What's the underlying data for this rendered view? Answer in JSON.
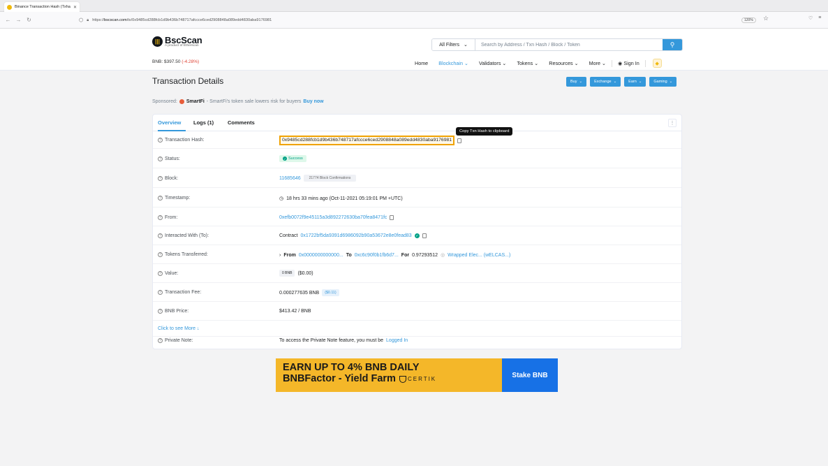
{
  "browser": {
    "tab_title": "Binance Transaction Hash (Txhas",
    "url_prefix": "https://",
    "url_domain": "bscscan.com",
    "url_path": "/tx/0x9485cd288fcb1d9b436b748717afccce6ced2908848a089edd4830aba9176981",
    "zoom": "120%"
  },
  "header": {
    "logo_name": "BscScan",
    "logo_sub": "A product of Etherscan",
    "bnb_price_label": "BNB: $397.50",
    "bnb_price_change": "(-4.28%)",
    "filter_label": "All Filters",
    "search_placeholder": "Search by Address / Txn Hash / Block / Token",
    "nav": {
      "home": "Home",
      "blockchain": "Blockchain",
      "validators": "Validators",
      "tokens": "Tokens",
      "resources": "Resources",
      "more": "More",
      "sign_in": "Sign In"
    }
  },
  "page": {
    "title": "Transaction Details",
    "buttons": {
      "buy": "Buy",
      "exchange": "Exchange",
      "earn": "Earn",
      "gaming": "Gaming"
    },
    "sponsored_label": "Sponsored:",
    "sponsor_name": "SmartFi",
    "sponsor_text": "- SmartFi's token sale lowers risk for buyers",
    "sponsor_cta": "Buy now"
  },
  "tabs": {
    "overview": "Overview",
    "logs": "Logs (1)",
    "comments": "Comments"
  },
  "tooltip": "Copy Txn Hash to clipboard",
  "details": {
    "tx_hash_label": "Transaction Hash:",
    "tx_hash": "0x9485cd288fcb1d9b436b748717afccce6ced2908848a089edd4830aba9176981",
    "status_label": "Status:",
    "status": "Success",
    "block_label": "Block:",
    "block": "11685646",
    "confirmations": "21774 Block Confirmations",
    "timestamp_label": "Timestamp:",
    "timestamp": "18 hrs 33 mins ago (Oct-11-2021 05:19:01 PM +UTC)",
    "from_label": "From:",
    "from": "0xefb0072f9e45115a3d892272630ba70fea8471fc",
    "interacted_label": "Interacted With (To):",
    "contract_word": "Contract",
    "contract": "0x1722bf5da9391d6986092b90a53672e8e0fead83",
    "tokens_label": "Tokens Transferred:",
    "tt_from_word": "From",
    "tt_from": "0x0000000000000...",
    "tt_to_word": "To",
    "tt_to": "0xc6c90f0b1fb6d7...",
    "tt_for_word": "For",
    "tt_amount": "0.97293512",
    "tt_token": "Wrapped Elec... (wELCAS...)",
    "value_label": "Value:",
    "value_bnb": "0 BNB",
    "value_usd": "($0.00)",
    "fee_label": "Transaction Fee:",
    "fee_bnb": "0.000277635 BNB",
    "fee_usd": "($0.11)",
    "price_label": "BNB Price:",
    "price": "$413.42 / BNB",
    "more_link": "Click to see More",
    "note_label": "Private Note:",
    "note_text": "To access the Private Note feature, you must be",
    "note_link": "Logged In"
  },
  "banner": {
    "line1": "EARN UP TO 4% BNB DAILY",
    "line2": "BNBFactor - Yield Farm",
    "certik": "CERTIK",
    "cta": "Stake BNB"
  },
  "icons": [
    "search-icon",
    "question-icon",
    "copy-icon",
    "check-icon",
    "clock-icon",
    "user-icon",
    "bnb-icon",
    "kebab-icon"
  ],
  "colors": {
    "accent": "#3498db",
    "success": "#00a186",
    "highlight": "#f0a202",
    "negative": "#de4437",
    "banner_yellow": "#f4b729",
    "banner_blue": "#1771e6"
  }
}
